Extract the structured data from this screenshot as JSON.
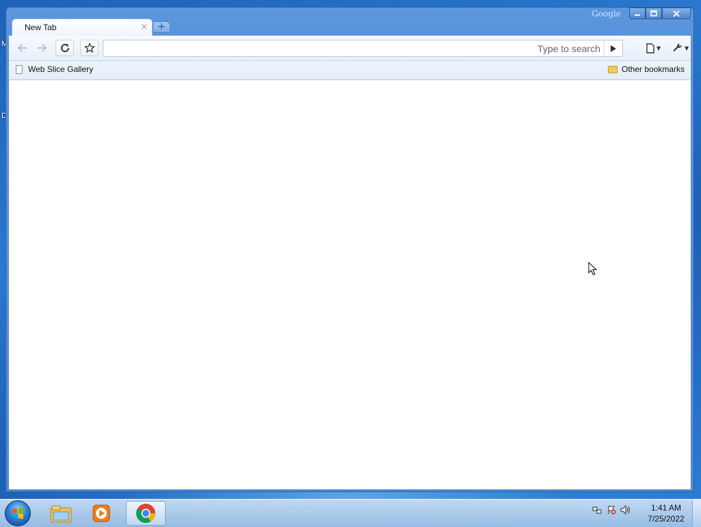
{
  "desktop": {
    "edge_text_top": "M",
    "edge_text_mid": "D"
  },
  "window": {
    "brand": "Google",
    "controls": {
      "minimize": "minimize-icon",
      "maximize": "maximize-icon",
      "close": "close-icon"
    },
    "tab": {
      "title": "New Tab",
      "close_symbol": "×"
    },
    "new_tab_symbol": "+"
  },
  "toolbar": {
    "back_icon": "back-arrow-icon",
    "forward_icon": "forward-arrow-icon",
    "reload_icon": "reload-icon",
    "star_icon": "bookmark-star-icon",
    "omnibox": {
      "value": "",
      "search_hint": "Type to search"
    },
    "go_icon": "play-icon",
    "page_menu_icon": "page-menu-icon",
    "wrench_menu_icon": "wrench-icon"
  },
  "bookmarks_bar": {
    "items": [
      {
        "label": "Web Slice Gallery",
        "icon": "page-icon"
      }
    ],
    "other": {
      "label": "Other bookmarks",
      "icon": "folder-icon"
    }
  },
  "taskbar": {
    "apps": [
      {
        "name": "Windows Explorer",
        "icon": "explorer-icon",
        "active": false
      },
      {
        "name": "Windows Media Player",
        "icon": "media-player-icon",
        "active": false
      },
      {
        "name": "Google Chrome",
        "icon": "chrome-icon",
        "active": true
      }
    ],
    "tray_icons": [
      "network-icon",
      "action-center-icon",
      "volume-icon"
    ],
    "clock": {
      "time": "1:41 AM",
      "date": "7/25/2022"
    }
  },
  "colors": {
    "desktop": "#1f63b8",
    "window_frame": "#5b95dd",
    "accent": "#4f89d6"
  }
}
